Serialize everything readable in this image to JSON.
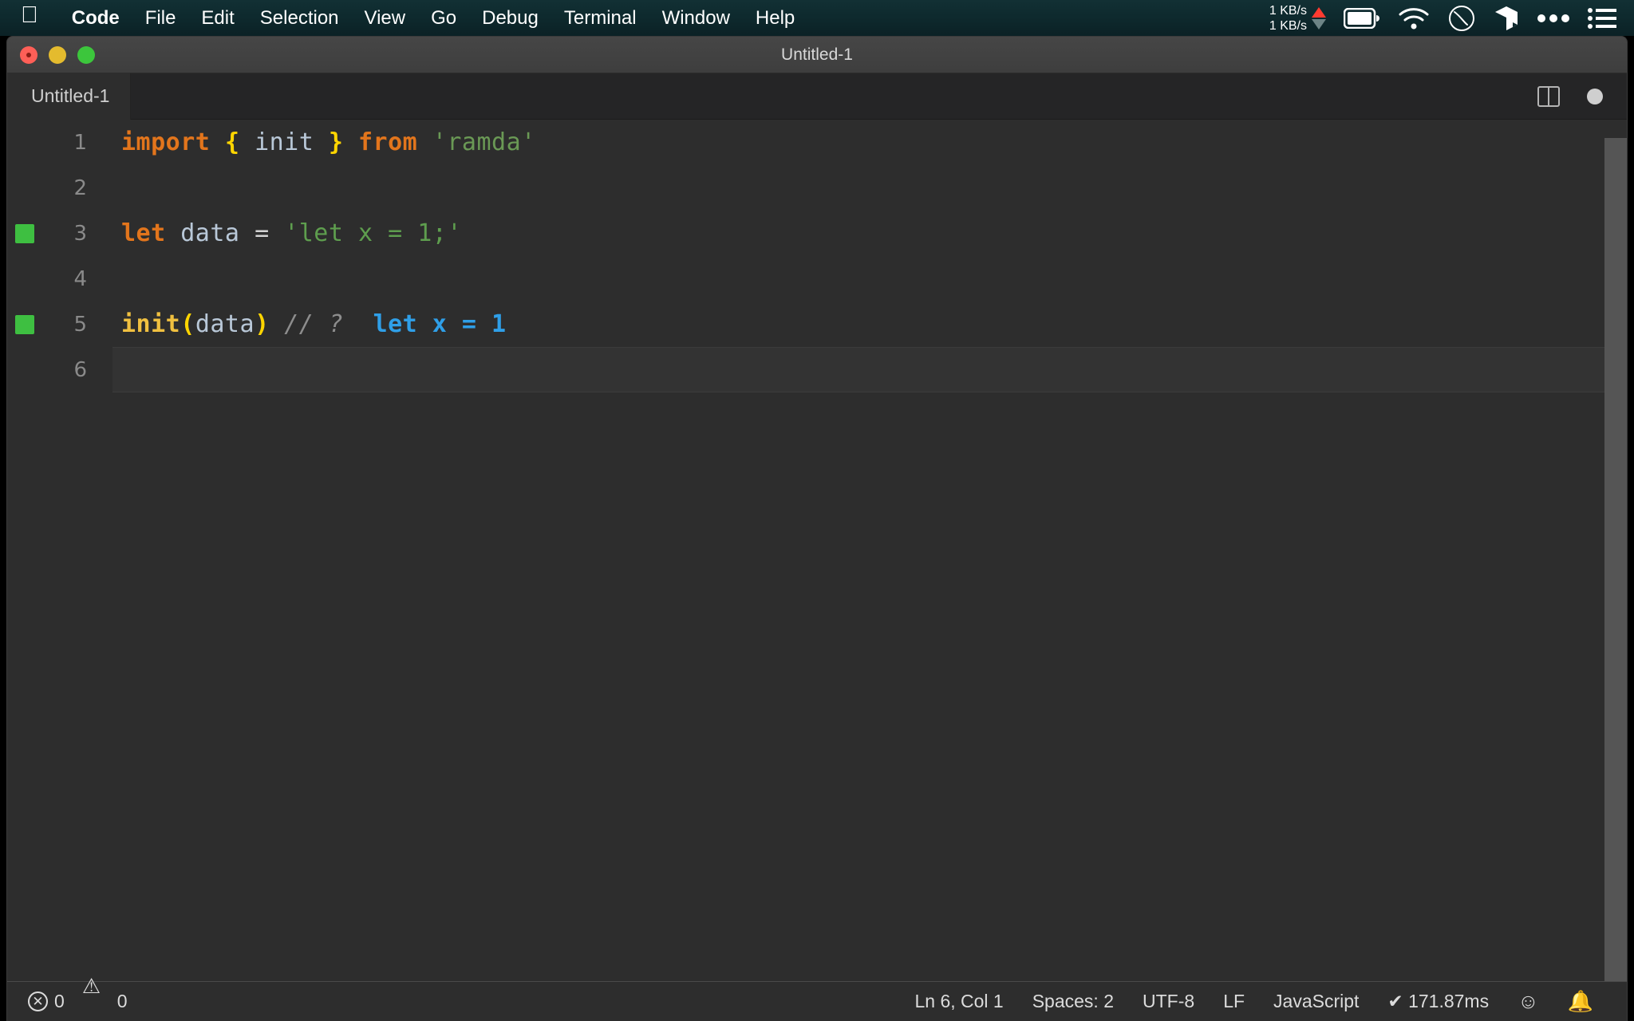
{
  "menubar": {
    "apple_logo": "apple-logo",
    "items": [
      {
        "label": "Code",
        "bold": true
      },
      {
        "label": "File",
        "bold": false
      },
      {
        "label": "Edit",
        "bold": false
      },
      {
        "label": "Selection",
        "bold": false
      },
      {
        "label": "View",
        "bold": false
      },
      {
        "label": "Go",
        "bold": false
      },
      {
        "label": "Debug",
        "bold": false
      },
      {
        "label": "Terminal",
        "bold": false
      },
      {
        "label": "Window",
        "bold": false
      },
      {
        "label": "Help",
        "bold": false
      }
    ],
    "network": {
      "upload": "1 KB/s",
      "download": "1 KB/s",
      "up_arrow_color": "#ff3b30",
      "down_arrow_color": "#6d8486"
    },
    "status_icons": [
      "battery-icon",
      "wifi-icon",
      "clock-icon",
      "dropbox-icon",
      "ellipsis-icon",
      "list-icon"
    ],
    "background_color": "#0e2a2e"
  },
  "window": {
    "title": "Untitled-1",
    "traffic_lights": [
      "close-button",
      "minimize-button",
      "zoom-button"
    ]
  },
  "tabbar": {
    "active_tab": "Untitled-1",
    "actions": [
      "split-editor-icon",
      "unsaved-dot-icon"
    ]
  },
  "editor": {
    "language": "javascript",
    "background_color": "#2d2d2d",
    "current_line": 6,
    "lines": [
      {
        "number": "1",
        "decoration": false,
        "current": false,
        "tokens": [
          {
            "text": "import",
            "class": "t-kw"
          },
          {
            "text": " ",
            "class": "t-op"
          },
          {
            "text": "{",
            "class": "t-brace"
          },
          {
            "text": " ",
            "class": "t-op"
          },
          {
            "text": "init",
            "class": "t-ident"
          },
          {
            "text": " ",
            "class": "t-op"
          },
          {
            "text": "}",
            "class": "t-brace"
          },
          {
            "text": " ",
            "class": "t-op"
          },
          {
            "text": "from",
            "class": "t-kw"
          },
          {
            "text": " ",
            "class": "t-op"
          },
          {
            "text": "'ramda'",
            "class": "t-str"
          }
        ]
      },
      {
        "number": "2",
        "decoration": false,
        "current": false,
        "tokens": []
      },
      {
        "number": "3",
        "decoration": true,
        "current": false,
        "tokens": [
          {
            "text": "let",
            "class": "t-kw"
          },
          {
            "text": " ",
            "class": "t-op"
          },
          {
            "text": "data",
            "class": "t-ident"
          },
          {
            "text": " ",
            "class": "t-op"
          },
          {
            "text": "=",
            "class": "t-op"
          },
          {
            "text": " ",
            "class": "t-op"
          },
          {
            "text": "'let x = 1;'",
            "class": "t-strg"
          }
        ]
      },
      {
        "number": "4",
        "decoration": false,
        "current": false,
        "tokens": []
      },
      {
        "number": "5",
        "decoration": true,
        "current": false,
        "tokens": [
          {
            "text": "init",
            "class": "t-fn"
          },
          {
            "text": "(",
            "class": "t-paren"
          },
          {
            "text": "data",
            "class": "t-ident"
          },
          {
            "text": ")",
            "class": "t-paren"
          },
          {
            "text": " ",
            "class": "t-op"
          },
          {
            "text": "// ?",
            "class": "t-comment"
          },
          {
            "text": "  ",
            "class": "t-op"
          },
          {
            "text": "let x = 1",
            "class": "t-blue"
          }
        ]
      },
      {
        "number": "6",
        "decoration": false,
        "current": true,
        "tokens": []
      }
    ]
  },
  "statusbar": {
    "errors": "0",
    "warnings": "0",
    "cursor_position": "Ln 6, Col 1",
    "indentation": "Spaces: 2",
    "encoding": "UTF-8",
    "eol": "LF",
    "language_mode": "JavaScript",
    "quokka_status": "✔ 171.87ms",
    "feedback_icon": "smiley-icon",
    "notifications_icon": "bell-icon"
  }
}
